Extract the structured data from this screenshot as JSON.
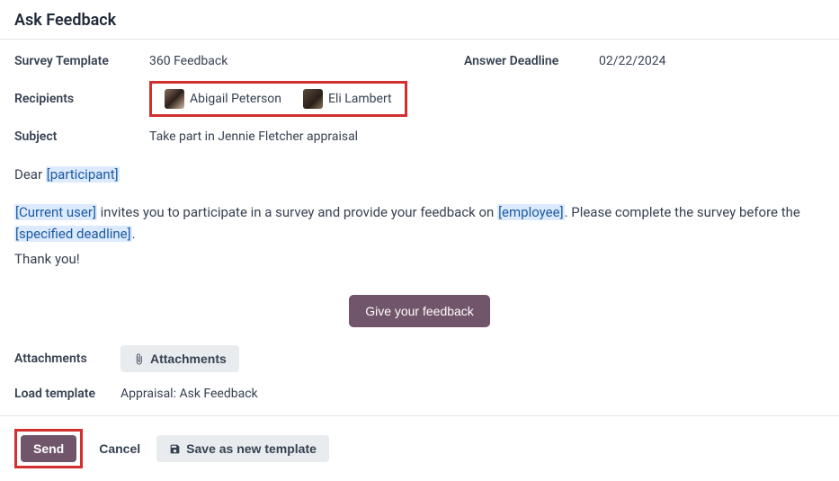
{
  "header": {
    "title": "Ask Feedback"
  },
  "form": {
    "survey_template_label": "Survey Template",
    "survey_template_value": "360 Feedback",
    "answer_deadline_label": "Answer Deadline",
    "answer_deadline_value": "02/22/2024",
    "recipients_label": "Recipients",
    "recipients": [
      {
        "name": "Abigail Peterson"
      },
      {
        "name": "Eli Lambert"
      }
    ],
    "subject_label": "Subject",
    "subject_value": "Take part in Jennie Fletcher appraisal"
  },
  "body": {
    "greeting_prefix": "Dear ",
    "placeholder_participant": "[participant]",
    "placeholder_current_user": "[Current user]",
    "segment_1": " invites you to participate in a survey and provide your feedback on ",
    "placeholder_employee": "[employee]",
    "segment_2": ". Please complete the survey before the ",
    "placeholder_deadline": "[specified deadline]",
    "segment_3": ".",
    "thankyou": "Thank you!",
    "feedback_button": "Give your feedback"
  },
  "attachments": {
    "label": "Attachments",
    "button": "Attachments",
    "load_template_label": "Load template",
    "load_template_value": "Appraisal: Ask Feedback"
  },
  "footer": {
    "send": "Send",
    "cancel": "Cancel",
    "save_template": "Save as new template"
  }
}
